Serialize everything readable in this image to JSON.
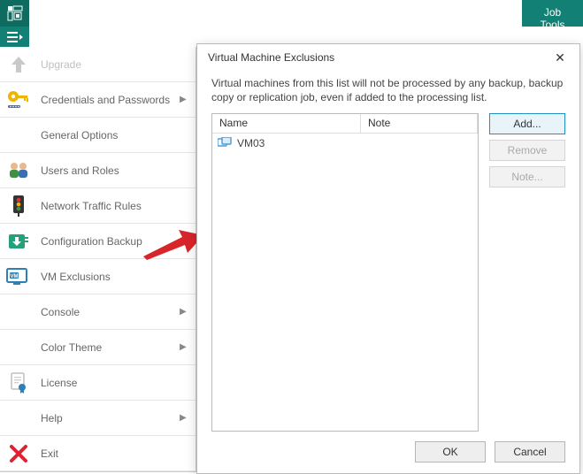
{
  "titlebar": {
    "tab": "Job Tools"
  },
  "menu": {
    "upgrade": "Upgrade",
    "credentials": "Credentials and Passwords",
    "general": "General Options",
    "users": "Users and Roles",
    "network": "Network Traffic Rules",
    "config": "Configuration Backup",
    "vm_excl": "VM Exclusions",
    "console": "Console",
    "color": "Color Theme",
    "license": "License",
    "help": "Help",
    "exit": "Exit"
  },
  "dialog": {
    "title": "Virtual Machine Exclusions",
    "desc": "Virtual machines from this list will not be processed by any backup, backup copy or replication job, even if added to the processing list.",
    "col_name": "Name",
    "col_note": "Note",
    "row_vm": "VM03",
    "btn_add": "Add...",
    "btn_remove": "Remove",
    "btn_note": "Note...",
    "btn_ok": "OK",
    "btn_cancel": "Cancel"
  }
}
